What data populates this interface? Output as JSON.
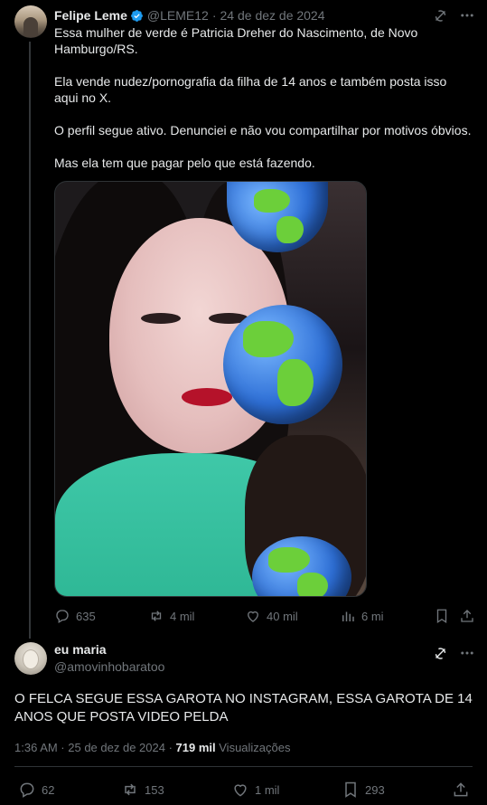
{
  "tweet1": {
    "name": "Felipe Leme",
    "handle": "@LEME12",
    "separator": "·",
    "date": "24 de dez de 2024",
    "paragraphs": [
      "Essa mulher de verde é Patricia Dreher do Nascimento, de Novo Hamburgo/RS.",
      "Ela vende nudez/pornografia da filha de 14 anos e também posta isso aqui no X.",
      "O perfil segue ativo. Denunciei e não vou compartilhar por motivos óbvios.",
      "Mas ela tem que pagar pelo que está fazendo."
    ],
    "replies": "635",
    "reposts": "4 mil",
    "likes": "40 mil",
    "views": "6 mi"
  },
  "tweet2": {
    "name": "eu maria",
    "handle": "@amovinhobaratoo",
    "text": "O FELCA SEGUE ESSA GAROTA NO INSTAGRAM, ESSA GAROTA DE 14 ANOS QUE POSTA VIDEO PELDA",
    "time": "1:36 AM · 25 de dez de 2024 ·",
    "views_count": "719 mil",
    "views_label": "Visualizações",
    "replies": "62",
    "reposts": "153",
    "likes": "1 mil",
    "bookmarks": "293"
  },
  "colors": {
    "text": "#e7e9ea",
    "muted": "#71767b",
    "verified": "#1d9bf0",
    "background": "#000000"
  },
  "icons": [
    "grok-icon",
    "more-icon",
    "reply-icon",
    "repost-icon",
    "like-icon",
    "views-icon",
    "bookmark-icon",
    "share-icon",
    "verified-badge-icon"
  ]
}
